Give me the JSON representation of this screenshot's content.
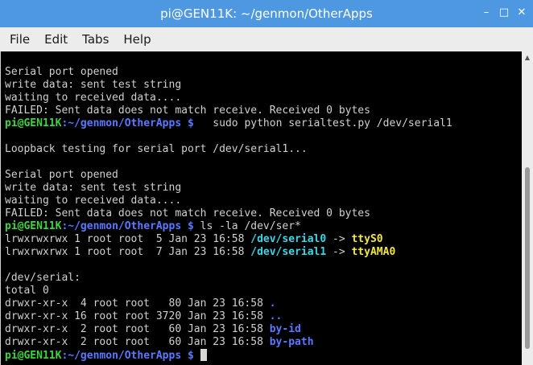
{
  "window": {
    "title": "pi@GEN11K: ~/genmon/OtherApps",
    "controls": {
      "minimize": "–",
      "maximize": "□",
      "close": "✕"
    }
  },
  "menu": [
    "File",
    "Edit",
    "Tabs",
    "Help"
  ],
  "terminal": {
    "lines": [
      {
        "type": "text",
        "text": "Serial port opened"
      },
      {
        "type": "text",
        "text": "write data: sent test string"
      },
      {
        "type": "text",
        "text": "waiting to received data...."
      },
      {
        "type": "text",
        "text": "FAILED: Sent data does not match receive. Received 0 bytes"
      },
      {
        "type": "prompt",
        "user": "pi@GEN11K",
        "path": ":~/genmon/OtherApps $",
        "command": "   sudo python serialtest.py /dev/serial1"
      },
      {
        "type": "text",
        "text": ""
      },
      {
        "type": "text",
        "text": "Loopback testing for serial port /dev/serial1..."
      },
      {
        "type": "text",
        "text": ""
      },
      {
        "type": "text",
        "text": "Serial port opened"
      },
      {
        "type": "text",
        "text": "write data: sent test string"
      },
      {
        "type": "text",
        "text": "waiting to received data...."
      },
      {
        "type": "text",
        "text": "FAILED: Sent data does not match receive. Received 0 bytes"
      },
      {
        "type": "prompt",
        "user": "pi@GEN11K",
        "path": ":~/genmon/OtherApps $",
        "command": " ls -la /dev/ser*"
      },
      {
        "type": "link",
        "prefix": "lrwxrwxrwx 1 root root  5 Jan 23 16:58 ",
        "name": "/dev/serial0",
        "arrow": " -> ",
        "target": "ttyS0"
      },
      {
        "type": "link",
        "prefix": "lrwxrwxrwx 1 root root  7 Jan 23 16:58 ",
        "name": "/dev/serial1",
        "arrow": " -> ",
        "target": "ttyAMA0"
      },
      {
        "type": "text",
        "text": ""
      },
      {
        "type": "text",
        "text": "/dev/serial:"
      },
      {
        "type": "text",
        "text": "total 0"
      },
      {
        "type": "dir",
        "prefix": "drwxr-xr-x  4 root root   80 Jan 23 16:58 ",
        "name": "."
      },
      {
        "type": "dir",
        "prefix": "drwxr-xr-x 16 root root 3720 Jan 23 16:58 ",
        "name": ".."
      },
      {
        "type": "dir",
        "prefix": "drwxr-xr-x  2 root root   60 Jan 23 16:58 ",
        "name": "by-id"
      },
      {
        "type": "dir",
        "prefix": "drwxr-xr-x  2 root root   60 Jan 23 16:58 ",
        "name": "by-path"
      },
      {
        "type": "prompt-cursor",
        "user": "pi@GEN11K",
        "path": ":~/genmon/OtherApps $",
        "command": " "
      }
    ]
  },
  "colors": {
    "titlebar": "#4d98e0",
    "prompt_user": "#3fd43f",
    "prompt_path": "#5b78ff",
    "symlink": "#3ad7e6",
    "device": "#f2e640",
    "directory": "#5b78ff"
  },
  "scrollbar": {
    "up_icon": "▲"
  }
}
